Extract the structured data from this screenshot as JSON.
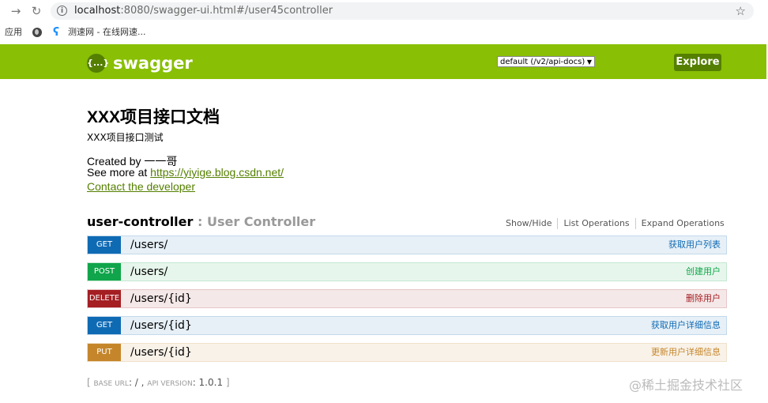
{
  "browser": {
    "url_host": "localhost",
    "url_path": ":8080/swagger-ui.html#/user45controller",
    "bookmarks": [
      {
        "label": "应用"
      },
      {
        "label": "测速网 - 在线网速..."
      }
    ]
  },
  "header": {
    "logo_icon": "{...}",
    "logo_text": "swagger",
    "spec_select": "default (/v2/api-docs)",
    "explore_label": "Explore"
  },
  "info": {
    "title": "XXX项目接口文档",
    "description": "XXX项目接口测试",
    "created_by": "Created by 一一哥",
    "see_more_prefix": "See more at ",
    "see_more_link": "https://yiyige.blog.csdn.net/",
    "contact": "Contact the developer"
  },
  "resource": {
    "name": "user-controller",
    "separator": " : ",
    "description": "User Controller",
    "actions": {
      "show_hide": "Show/Hide",
      "list_operations": "List Operations",
      "expand_operations": "Expand Operations"
    },
    "operations": [
      {
        "method": "GET",
        "path": "/users/",
        "summary": "获取用户列表"
      },
      {
        "method": "POST",
        "path": "/users/",
        "summary": "创建用户"
      },
      {
        "method": "DELETE",
        "path": "/users/{id}",
        "summary": "删除用户"
      },
      {
        "method": "GET",
        "path": "/users/{id}",
        "summary": "获取用户详细信息"
      },
      {
        "method": "PUT",
        "path": "/users/{id}",
        "summary": "更新用户详细信息"
      }
    ]
  },
  "footer": {
    "open": "[ ",
    "base_url_label": "BASE URL",
    "base_url_value": ": / , ",
    "api_version_label": "API VERSION",
    "api_version_value": ": 1.0.1 ",
    "close": "]"
  },
  "watermark": "@稀土掘金技术社区",
  "colors": {
    "header_green": "#89bf04",
    "get": "#0f6ab4",
    "post": "#10a54a",
    "delete": "#a41e22",
    "put": "#c5862b"
  }
}
